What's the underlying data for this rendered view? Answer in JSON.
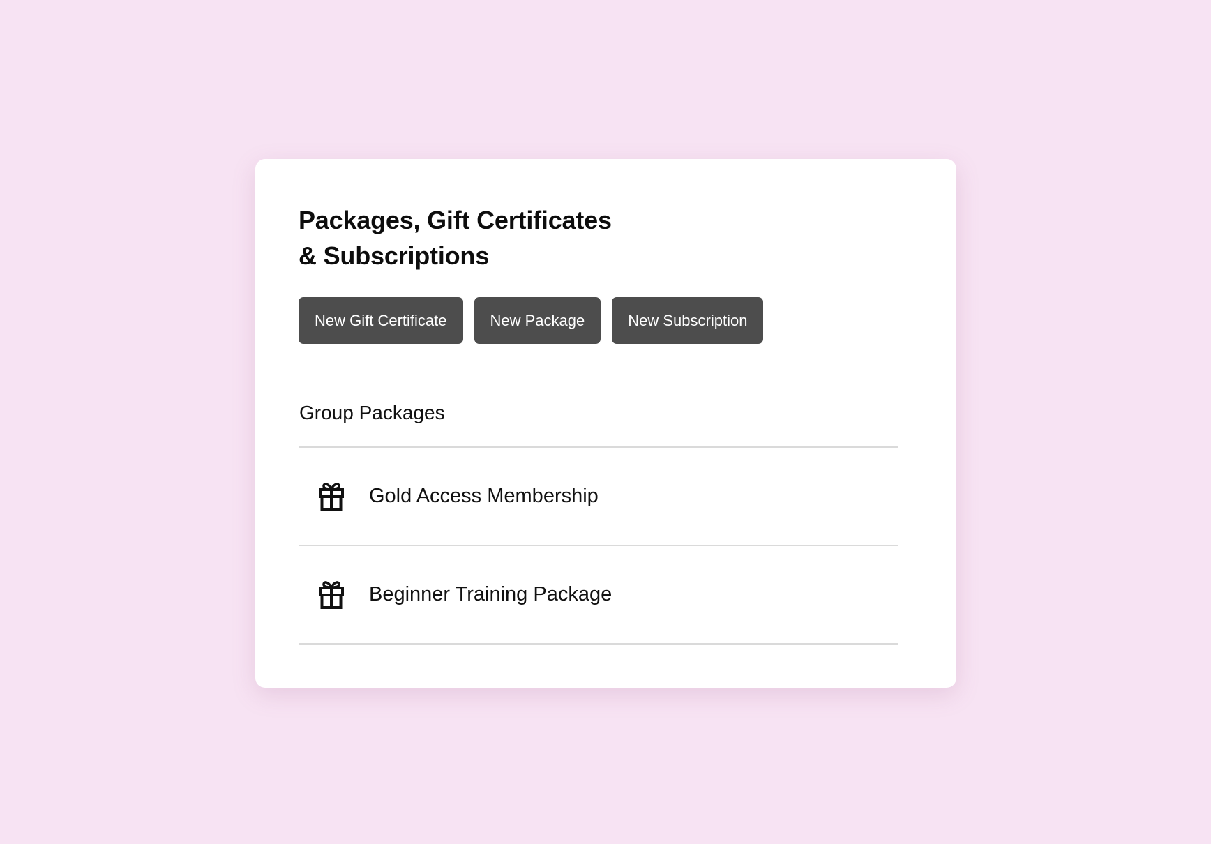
{
  "card": {
    "title_line1": "Packages, Gift Certificates",
    "title_line2": "& Subscriptions",
    "buttons": [
      {
        "label": "New Gift Certificate"
      },
      {
        "label": "New Package"
      },
      {
        "label": "New Subscription"
      }
    ],
    "section_title": "Group Packages",
    "items": [
      {
        "label": "Gold Access Membership",
        "icon": "gift-icon"
      },
      {
        "label": "Beginner Training Package",
        "icon": "gift-icon"
      }
    ]
  },
  "colors": {
    "background": "#f7e3f3",
    "card": "#ffffff",
    "button": "#4d4d4d",
    "button_text": "#ffffff",
    "divider": "#dadada"
  }
}
